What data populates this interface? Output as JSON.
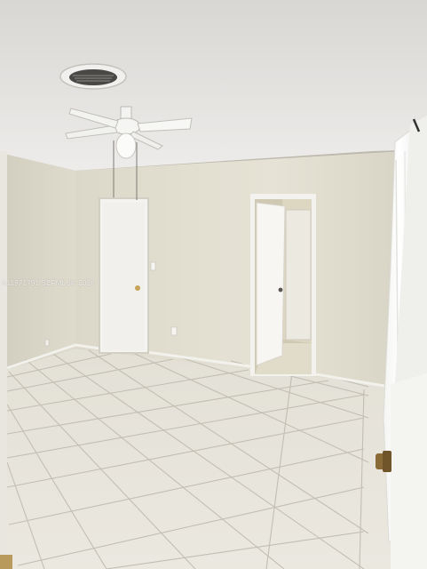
{
  "photo": {
    "subject": "empty-room",
    "watermark": "A11971791 SEFMLS© 2026"
  },
  "colors": {
    "ceiling": "#e6e4e1",
    "wall": "#e4e1d4",
    "wall_shadow": "#c9c5b5",
    "floor_tile": "#e8e5dc",
    "grout": "#bdb9ae",
    "door": "#f3f2ee",
    "trim": "#f4f3ef"
  },
  "icons": [
    "ceiling-vent-icon",
    "ceiling-fan-icon",
    "door-knob-icon",
    "light-switch-icon",
    "outlet-icon"
  ]
}
